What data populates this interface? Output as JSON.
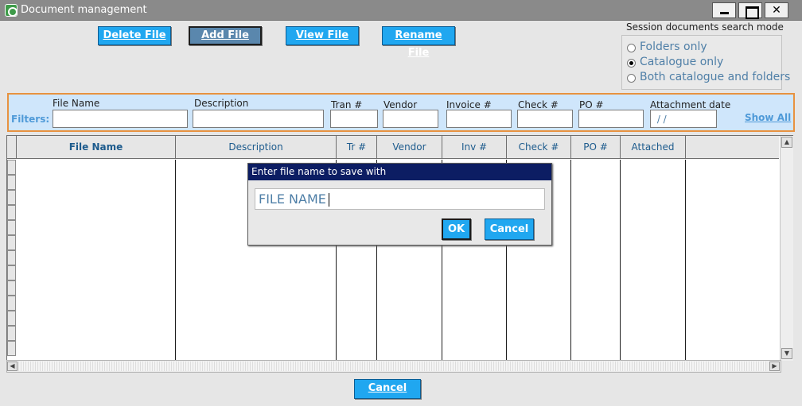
{
  "window": {
    "title": "Document management"
  },
  "toolbar": {
    "delete": "Delete File",
    "add": "Add File",
    "view": "View File",
    "rename": "Rename File"
  },
  "search_mode": {
    "title": "Session documents search mode",
    "options": [
      {
        "label": "Folders only",
        "selected": false
      },
      {
        "label": "Catalogue only",
        "selected": true
      },
      {
        "label": "Both catalogue and folders",
        "selected": false
      }
    ]
  },
  "filters": {
    "label": "Filters:",
    "fields": [
      {
        "label": "File Name",
        "value": ""
      },
      {
        "label": "Description",
        "value": ""
      },
      {
        "label": "Tran #",
        "value": ""
      },
      {
        "label": "Vendor",
        "value": ""
      },
      {
        "label": "Invoice #",
        "value": ""
      },
      {
        "label": "Check #",
        "value": ""
      },
      {
        "label": "PO #",
        "value": ""
      },
      {
        "label": "Attachment date",
        "value": " / /"
      }
    ],
    "show_all": "Show All"
  },
  "grid": {
    "columns": [
      "File Name",
      "Description",
      "Tr #",
      "Vendor",
      "Inv #",
      "Check #",
      "PO #",
      "Attached"
    ]
  },
  "dialog": {
    "title": "Enter file name to save with",
    "input_value": "FILE NAME",
    "ok": "OK",
    "cancel": "Cancel"
  },
  "footer": {
    "cancel": "Cancel"
  },
  "colors": {
    "button": "#20a7f0",
    "button_active": "#5a87ad",
    "filter_bg": "#cfe6fb",
    "filter_border": "#e8923f",
    "dialog_title": "#0c1d63"
  }
}
